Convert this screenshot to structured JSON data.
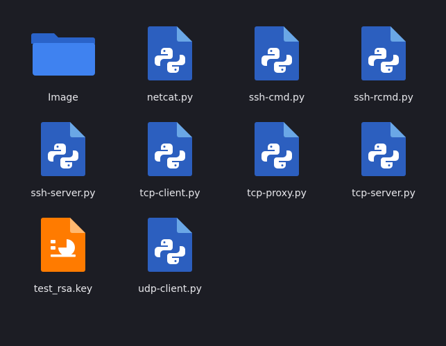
{
  "files": [
    {
      "name": "Image",
      "type": "folder",
      "icon": "folder-icon"
    },
    {
      "name": "netcat.py",
      "type": "python",
      "icon": "python-file-icon"
    },
    {
      "name": "ssh-cmd.py",
      "type": "python",
      "icon": "python-file-icon"
    },
    {
      "name": "ssh-rcmd.py",
      "type": "python",
      "icon": "python-file-icon"
    },
    {
      "name": "ssh-server.py",
      "type": "python",
      "icon": "python-file-icon"
    },
    {
      "name": "tcp-client.py",
      "type": "python",
      "icon": "python-file-icon"
    },
    {
      "name": "tcp-proxy.py",
      "type": "python",
      "icon": "python-file-icon"
    },
    {
      "name": "tcp-server.py",
      "type": "python",
      "icon": "python-file-icon"
    },
    {
      "name": "test_rsa.key",
      "type": "key",
      "icon": "presentation-file-icon"
    },
    {
      "name": "udp-client.py",
      "type": "python",
      "icon": "python-file-icon"
    }
  ],
  "colors": {
    "background": "#1c1d24",
    "folder": "#3f82f0",
    "folder_back": "#2a63c9",
    "python_doc": "#2c5fbf",
    "python_fold": "#6aa7e6",
    "key_doc": "#ff7b00",
    "key_fold": "#ffb870",
    "label": "#e6e6ea"
  }
}
